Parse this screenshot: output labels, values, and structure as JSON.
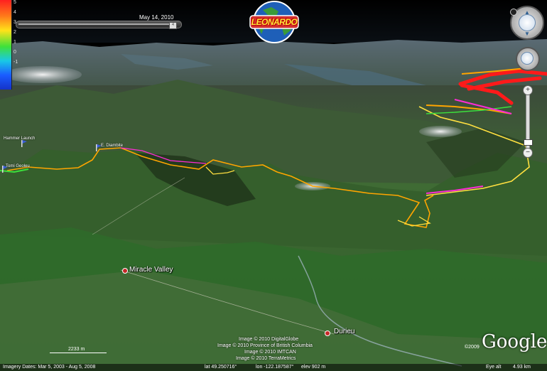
{
  "legend": {
    "ticks": [
      "5",
      "4",
      "3",
      "2",
      "1",
      "0",
      "-1"
    ]
  },
  "timeline": {
    "date_label": "May 14, 2010",
    "thumb_label": "4"
  },
  "logo": {
    "text": "LEONARDO"
  },
  "waypoints": [
    {
      "id": "hammer-launch",
      "label": "Hammer Launch"
    },
    {
      "id": "waypoint-left",
      "label": "Tomi Geoleu"
    },
    {
      "id": "waypoint-mid",
      "label": "E. Diambite"
    }
  ],
  "places": [
    {
      "id": "miracle-valley",
      "label": "Miracle Valley"
    },
    {
      "id": "durieu",
      "label": "Durieu"
    }
  ],
  "credits": [
    "Image © 2010 DigitalGlobe",
    "Image © 2010 Province of British Columbia",
    "Image © 2010 IMTCAN",
    "Image © 2010 TerraMetrics"
  ],
  "scale": {
    "label": "2233 m"
  },
  "status": {
    "imagery_dates": "Imagery Dates: Mar 5, 2003 - Aug 5, 2008",
    "lat": "lat  49.250716°",
    "lon": "lon -122.187587°",
    "elev": "elev  902 m",
    "eye_alt_label": "Eye alt",
    "eye_alt_value": "4.93 km"
  },
  "google": {
    "logo": "Google",
    "copyright": "©2009"
  },
  "controls": {
    "zoom_in": "+",
    "zoom_out": "−"
  },
  "colors": {
    "track_red": "#ff1a1a",
    "track_orange": "#ffa500",
    "track_yellow": "#ffe040",
    "track_magenta": "#ff2bd6",
    "track_green": "#3ce03c",
    "place_marker": "#c62828"
  },
  "icons": [
    "compass-icon",
    "navigation-control-icon",
    "zoom-in-icon",
    "zoom-out-icon",
    "flag-icon",
    "place-marker-icon"
  ]
}
